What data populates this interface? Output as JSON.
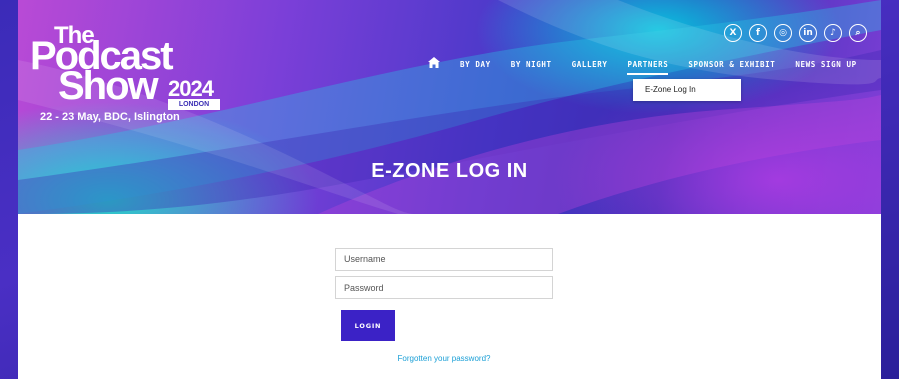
{
  "logo": {
    "line1": "The",
    "line2": "Podcast",
    "line3": "Show",
    "year": "2024",
    "city": "LONDON"
  },
  "event_dates": "22 - 23 May, BDC, Islington",
  "social": [
    {
      "icon": "x-icon",
      "glyph": "X"
    },
    {
      "icon": "facebook-icon",
      "glyph": "f"
    },
    {
      "icon": "instagram-icon",
      "glyph": "◎"
    },
    {
      "icon": "linkedin-icon",
      "glyph": "in"
    },
    {
      "icon": "tiktok-icon",
      "glyph": "♪"
    },
    {
      "icon": "search-icon",
      "glyph": "⌕"
    }
  ],
  "nav": {
    "home_icon": "home-icon",
    "items": [
      "BY DAY",
      "BY NIGHT",
      "GALLERY",
      "PARTNERS",
      "SPONSOR & EXHIBIT",
      "NEWS SIGN UP"
    ],
    "active": "PARTNERS",
    "dropdown": [
      "E-Zone Log In"
    ]
  },
  "page_title": "E-ZONE LOG IN",
  "form": {
    "username_placeholder": "Username",
    "password_placeholder": "Password",
    "login_label": "LOGIN",
    "forgot_label": "Forgotten your password?"
  },
  "colors": {
    "accent": "#3b22c6",
    "link": "#1a9fd6"
  }
}
